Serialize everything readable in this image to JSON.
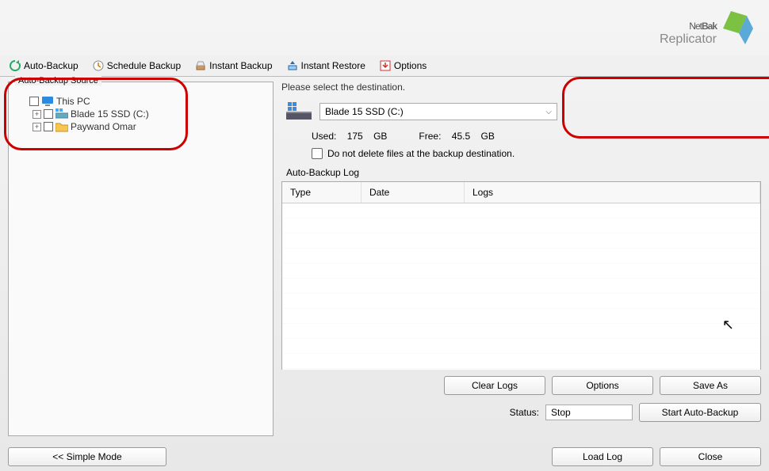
{
  "logo": {
    "main1": "Net",
    "main2": "Bak",
    "sub": "Replicator"
  },
  "toolbar": {
    "auto_backup": "Auto-Backup",
    "schedule_backup": "Schedule Backup",
    "instant_backup": "Instant Backup",
    "instant_restore": "Instant Restore",
    "options": "Options"
  },
  "source": {
    "panel_title": "Auto-Backup Source",
    "root": "This PC",
    "items": [
      {
        "label": "Blade 15 SSD (C:)"
      },
      {
        "label": "Paywand Omar"
      }
    ]
  },
  "destination": {
    "prompt": "Please select the destination.",
    "selected": "Blade 15 SSD (C:)",
    "used_label": "Used:",
    "used_val": "175",
    "used_unit": "GB",
    "free_label": "Free:",
    "free_val": "45.5",
    "free_unit": "GB",
    "no_delete": "Do not delete files at the backup destination."
  },
  "log": {
    "title": "Auto-Backup Log",
    "col_type": "Type",
    "col_date": "Date",
    "col_logs": "Logs"
  },
  "buttons": {
    "clear_logs": "Clear Logs",
    "options": "Options",
    "save_as": "Save As",
    "simple_mode": "<< Simple Mode",
    "load_log": "Load Log",
    "close": "Close",
    "start_auto": "Start Auto-Backup"
  },
  "status": {
    "label": "Status:",
    "value": "Stop"
  }
}
